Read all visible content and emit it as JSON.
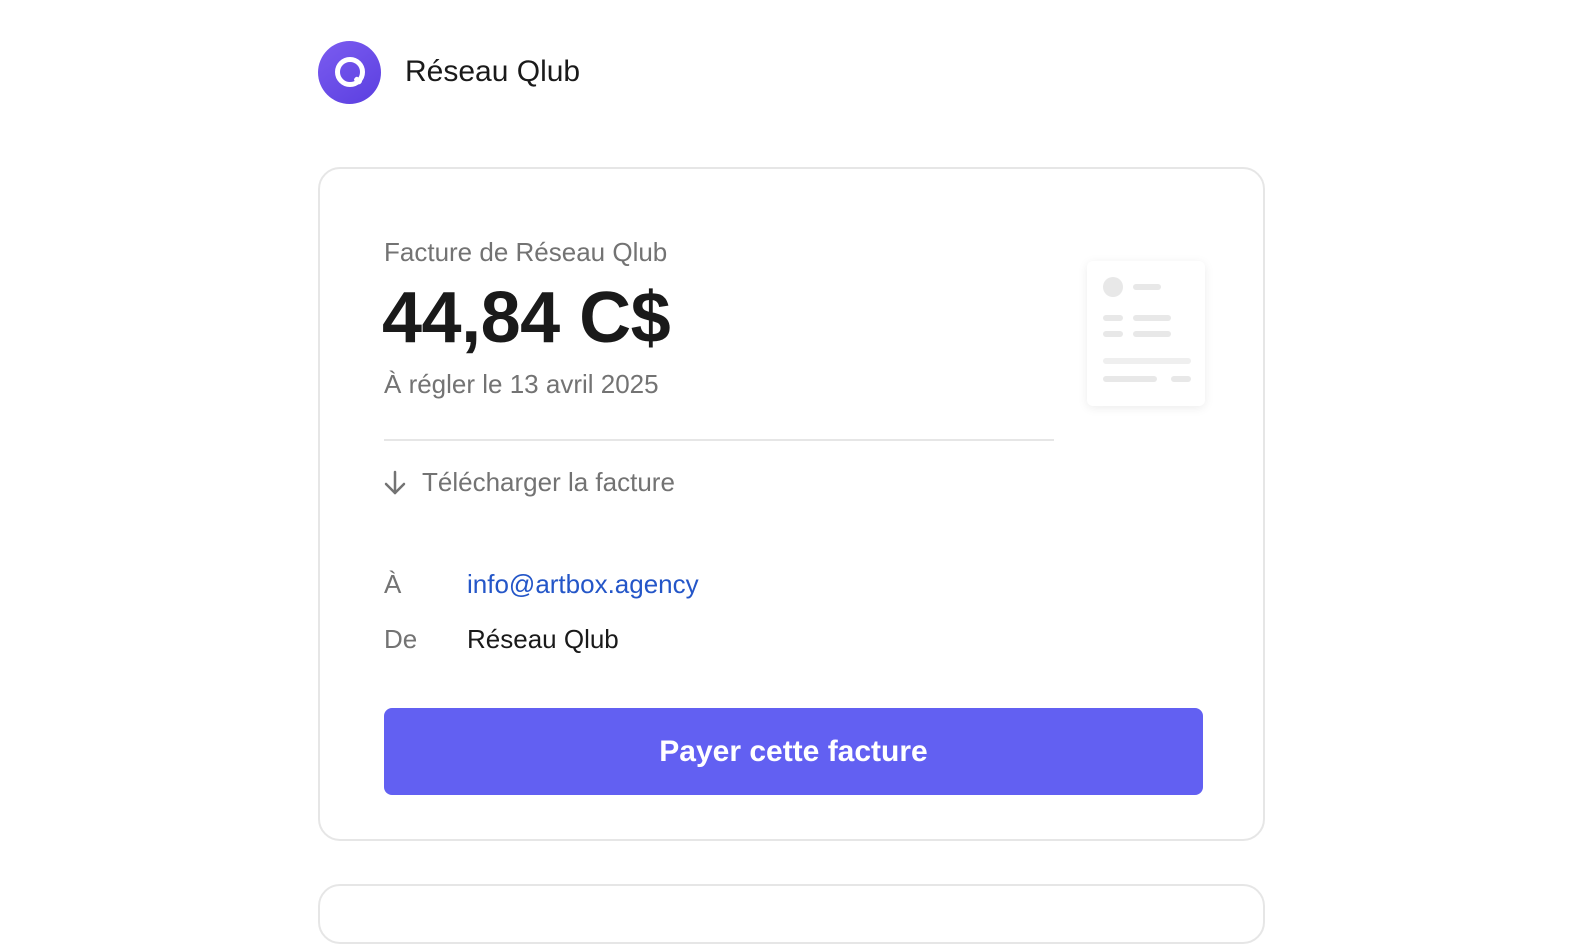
{
  "brand": {
    "name": "Réseau Qlub",
    "logo_icon": "qlub-q-logo-icon",
    "logo_color": "#6b4df0"
  },
  "invoice": {
    "from_label": "Facture de Réseau Qlub",
    "amount": "44,84 C$",
    "due_text": "À régler le 13 avril 2025",
    "download_label": "Télécharger la facture",
    "download_icon": "arrow-down-icon",
    "to_label": "À",
    "to_value": "info@artbox.agency",
    "from_row_label": "De",
    "from_row_value": "Réseau Qlub",
    "pay_button_label": "Payer cette facture"
  },
  "colors": {
    "accent": "#6260f2",
    "link": "#2456c8",
    "muted_text": "#737373"
  }
}
